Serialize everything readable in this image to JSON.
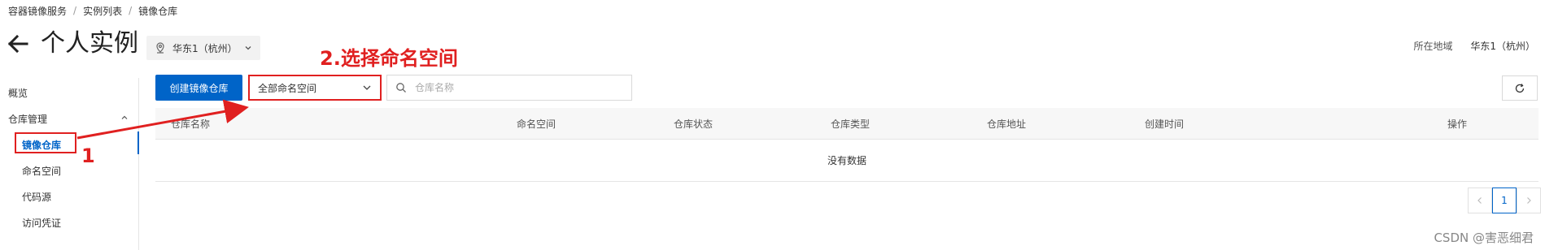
{
  "breadcrumb": [
    "容器镜像服务",
    "实例列表",
    "镜像仓库"
  ],
  "header": {
    "title": "个人实例",
    "region_select": "华东1（杭州）",
    "region_label": "所在地域",
    "region_value": "华东1（杭州）"
  },
  "sidebar": {
    "overview": "概览",
    "group": "仓库管理",
    "items": [
      {
        "label": "镜像仓库",
        "active": true
      },
      {
        "label": "命名空间",
        "active": false
      },
      {
        "label": "代码源",
        "active": false
      },
      {
        "label": "访问凭证",
        "active": false
      }
    ]
  },
  "toolbar": {
    "create_label": "创建镜像仓库",
    "namespace_select": "全部命名空间",
    "search_placeholder": "仓库名称"
  },
  "table": {
    "columns": [
      "仓库名称",
      "命名空间",
      "仓库状态",
      "仓库类型",
      "仓库地址",
      "创建时间",
      "操作"
    ],
    "empty_text": "没有数据"
  },
  "pagination": {
    "current_page": "1"
  },
  "annotations": {
    "step2": "2.选择命名空间",
    "step1": "1"
  },
  "watermark": "CSDN @害恶细君",
  "colors": {
    "accent": "#0064c8",
    "annotation": "#e02020"
  },
  "icons": [
    "back-arrow-icon",
    "location-pin-icon",
    "chevron-down-icon",
    "chevron-up-icon",
    "search-icon",
    "refresh-icon",
    "chevron-left-icon",
    "chevron-right-icon"
  ]
}
